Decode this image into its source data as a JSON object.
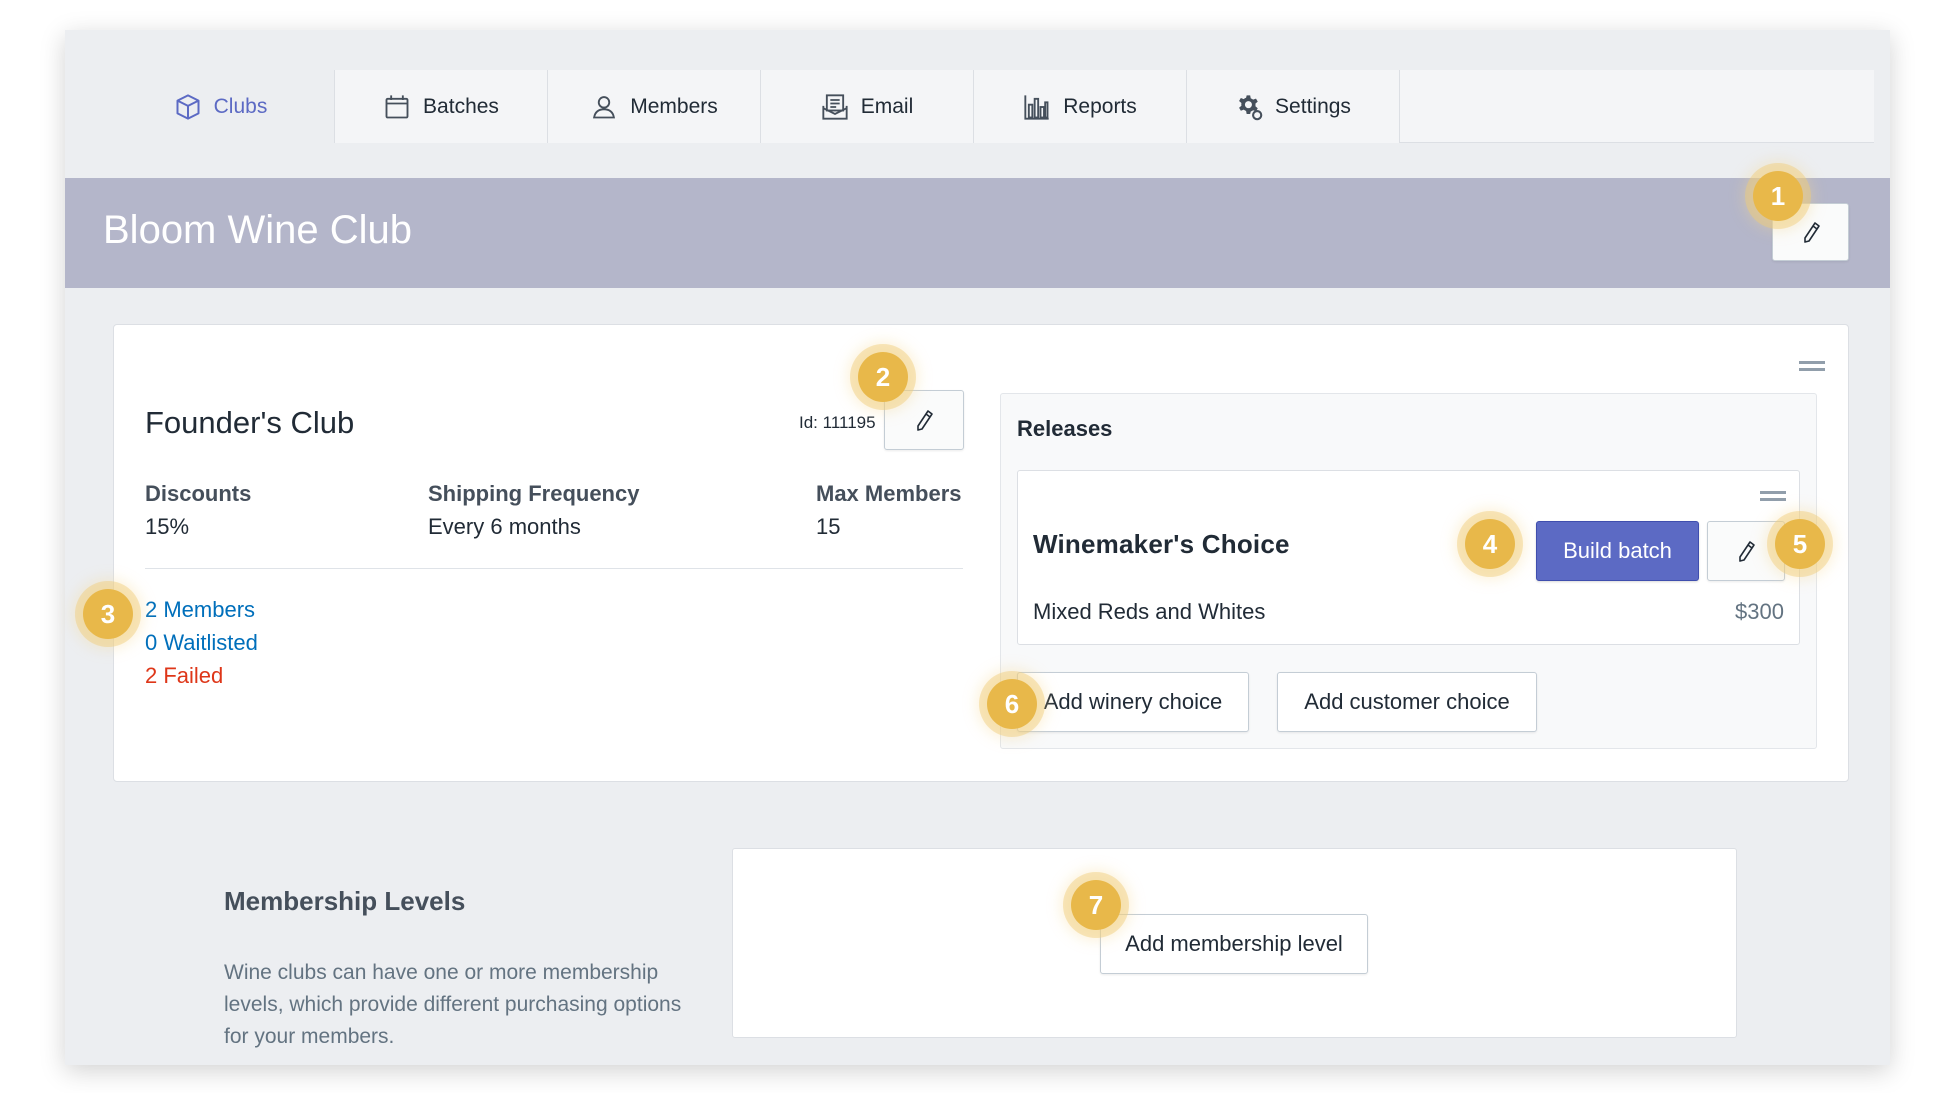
{
  "tabs": [
    {
      "label": "Clubs",
      "icon": "box-icon",
      "active": true
    },
    {
      "label": "Batches",
      "icon": "calendar-icon"
    },
    {
      "label": "Members",
      "icon": "user-icon"
    },
    {
      "label": "Email",
      "icon": "email-icon"
    },
    {
      "label": "Reports",
      "icon": "bar-chart-icon"
    },
    {
      "label": "Settings",
      "icon": "gear-icon"
    }
  ],
  "header": {
    "club_name": "Bloom Wine Club"
  },
  "level": {
    "name": "Founder's Club",
    "id_label": "Id: 111195",
    "stats": [
      {
        "label": "Discounts",
        "value": "15%"
      },
      {
        "label": "Shipping Frequency",
        "value": "Every 6 months"
      },
      {
        "label": "Max Members",
        "value": "15"
      }
    ],
    "links": {
      "members": "2 Members",
      "waitlisted": "0 Waitlisted",
      "failed": "2 Failed"
    }
  },
  "releases": {
    "title": "Releases",
    "items": [
      {
        "name": "Winemaker's Choice",
        "description": "Mixed Reds and Whites",
        "price": "$300",
        "build_label": "Build batch"
      }
    ],
    "add_winery_label": "Add winery choice",
    "add_customer_label": "Add customer choice"
  },
  "membership_levels": {
    "title": "Membership Levels",
    "description": "Wine clubs can have one or more membership levels, which provide different purchasing options for your members.",
    "add_label": "Add membership level"
  },
  "callouts": [
    "1",
    "2",
    "3",
    "4",
    "5",
    "6",
    "7"
  ],
  "colors": {
    "accent": "#5c6ac4",
    "header_band": "#b4b6ca",
    "link": "#006fbb",
    "failed": "#de3618",
    "callout": "#e8b84a"
  }
}
